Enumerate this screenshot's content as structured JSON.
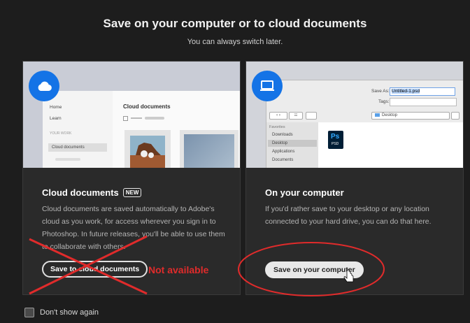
{
  "header": {
    "title": "Save on your computer or to cloud documents",
    "subtitle": "You can always switch later."
  },
  "cloud_card": {
    "preview": {
      "nav": [
        "Home",
        "Learn"
      ],
      "section_label": "YOUR WORK",
      "selected_nav": "Cloud documents",
      "heading": "Cloud documents"
    },
    "title": "Cloud documents",
    "badge": "NEW",
    "description": "Cloud documents are saved automatically to Adobe's cloud as you work, for access wherever you sign in to Photoshop. In future releases, you'll be able to use them to collaborate with others.",
    "button_label": "Save to cloud documents",
    "annotation": "Not available"
  },
  "computer_card": {
    "preview": {
      "save_as_label": "Save As:",
      "save_as_value": "Untitled-1.psd",
      "tags_label": "Tags:",
      "location": "Desktop",
      "sidebar_header": "Favorites",
      "sidebar_items": [
        "Downloads",
        "Desktop",
        "Applications",
        "Documents"
      ],
      "file_icon_text": "Ps",
      "file_icon_sub": "PSD"
    },
    "title": "On your computer",
    "description": "If you'd rather save to your desktop or any location connected to your hard drive, you can do that here.",
    "button_label": "Save on your computer"
  },
  "footer": {
    "checkbox_label": "Don't show again",
    "checked": false
  },
  "colors": {
    "accent": "#1473e6",
    "annotation_red": "#e02b2b",
    "background": "#1d1d1d"
  }
}
